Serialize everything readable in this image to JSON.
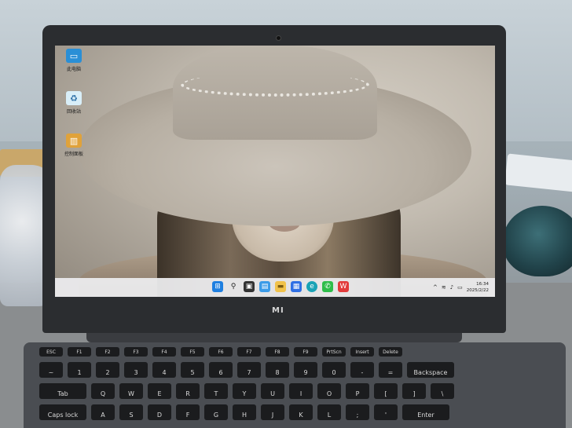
{
  "desktop": {
    "icons": [
      {
        "label": "此电脑",
        "icon": "computer-icon"
      },
      {
        "label": "回收站",
        "icon": "recycle-bin-icon"
      },
      {
        "label": "控制面板",
        "icon": "control-panel-icon"
      }
    ]
  },
  "taskbar": {
    "apps": [
      {
        "name": "start",
        "glyph": "⊞"
      },
      {
        "name": "search",
        "glyph": "⚲"
      },
      {
        "name": "task-view",
        "glyph": "▣"
      },
      {
        "name": "widgets",
        "glyph": "▤"
      },
      {
        "name": "file-explorer",
        "glyph": "▬"
      },
      {
        "name": "store",
        "glyph": "▦"
      },
      {
        "name": "edge",
        "glyph": "e"
      },
      {
        "name": "wechat",
        "glyph": "✆"
      },
      {
        "name": "wps",
        "glyph": "W"
      }
    ],
    "tray": {
      "time": "16:34",
      "date": "2025/2/22"
    }
  },
  "laptop": {
    "brand": "MI"
  },
  "keyboard": {
    "fn_row": [
      "ESC",
      "F1",
      "F2",
      "F3",
      "F4",
      "F5",
      "F6",
      "F7",
      "F8",
      "F9",
      "PrtScn",
      "Insert",
      "Delete"
    ],
    "number_row": [
      "~",
      "1",
      "2",
      "3",
      "4",
      "5",
      "6",
      "7",
      "8",
      "9",
      "0",
      "-",
      "=",
      "Backspace"
    ],
    "qwerty_row": [
      "Tab",
      "Q",
      "W",
      "E",
      "R",
      "T",
      "Y",
      "U",
      "I",
      "O",
      "P",
      "[",
      "]",
      "\\"
    ],
    "home_row": [
      "Caps lock",
      "A",
      "S",
      "D",
      "F",
      "G",
      "H",
      "J",
      "K",
      "L",
      ";",
      "'",
      "Enter"
    ]
  }
}
